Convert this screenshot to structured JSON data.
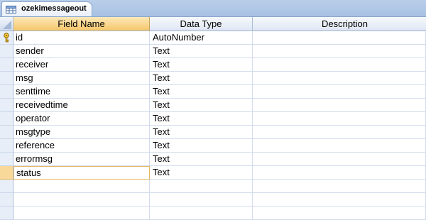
{
  "tab": {
    "title": "ozekimessageout",
    "icon": "table-icon"
  },
  "grid": {
    "headers": {
      "field_name": "Field Name",
      "data_type": "Data Type",
      "description": "Description"
    },
    "rows": [
      {
        "name": "id",
        "type": "AutoNumber",
        "primary_key": true
      },
      {
        "name": "sender",
        "type": "Text"
      },
      {
        "name": "receiver",
        "type": "Text"
      },
      {
        "name": "msg",
        "type": "Text"
      },
      {
        "name": "senttime",
        "type": "Text"
      },
      {
        "name": "receivedtime",
        "type": "Text"
      },
      {
        "name": "operator",
        "type": "Text"
      },
      {
        "name": "msgtype",
        "type": "Text"
      },
      {
        "name": "reference",
        "type": "Text"
      },
      {
        "name": "errormsg",
        "type": "Text"
      },
      {
        "name": "status",
        "type": "Text",
        "current": true
      },
      {
        "name": "",
        "type": ""
      },
      {
        "name": "",
        "type": ""
      },
      {
        "name": "",
        "type": ""
      }
    ]
  },
  "colors": {
    "selected_header": "#f6c66a",
    "current_row_border": "#e5b65f",
    "tab_strip": "#a8c1e3"
  }
}
